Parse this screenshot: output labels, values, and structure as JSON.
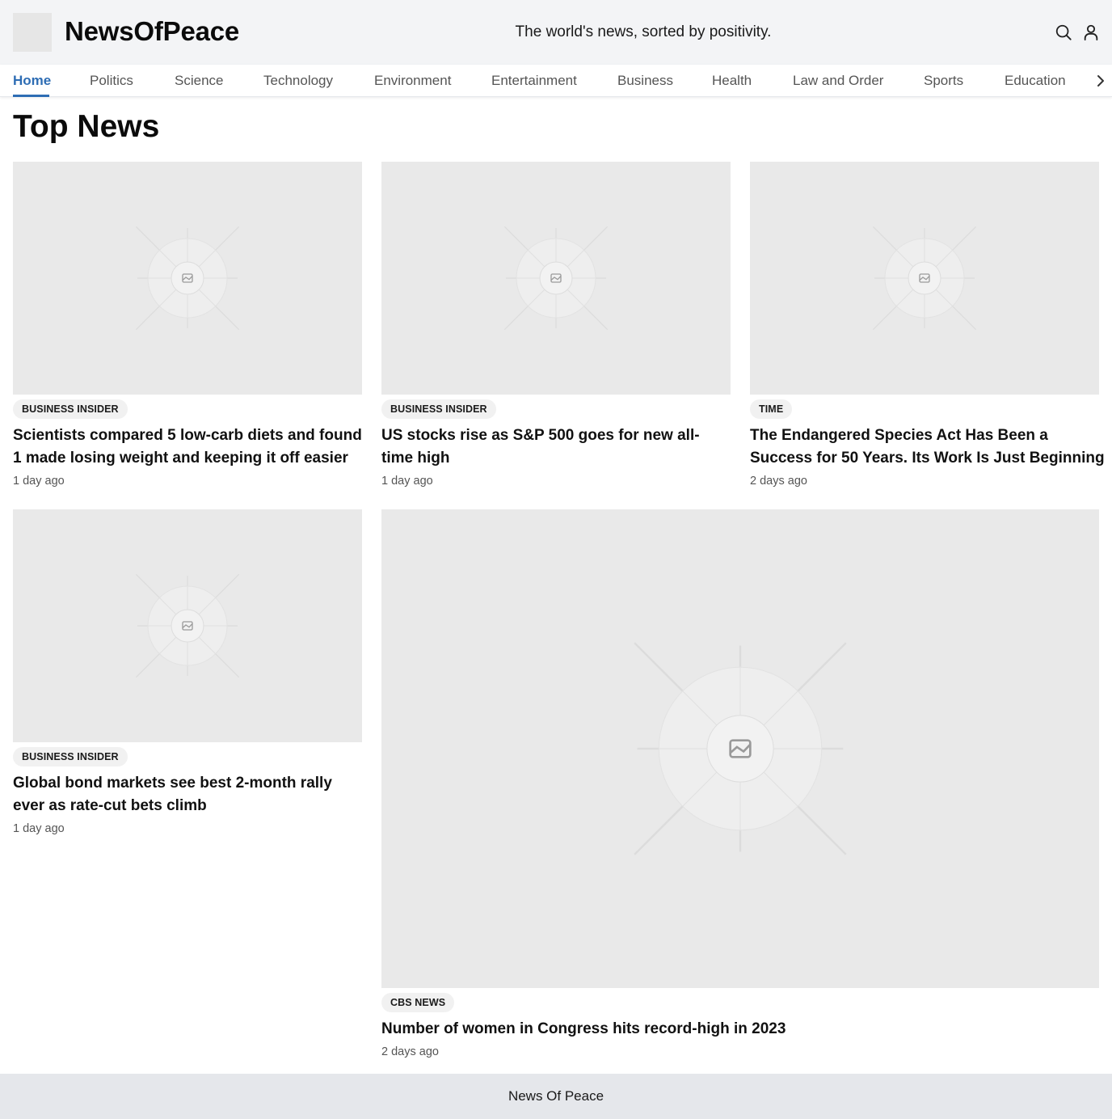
{
  "header": {
    "brand": "NewsOfPeace",
    "tagline": "The world's news, sorted by positivity.",
    "icons": [
      "search-icon",
      "user-icon"
    ]
  },
  "nav": {
    "items": [
      "Home",
      "Politics",
      "Science",
      "Technology",
      "Environment",
      "Entertainment",
      "Business",
      "Health",
      "Law and Order",
      "Sports",
      "Education"
    ],
    "active": "Home",
    "next_icon": "chevron-right-icon"
  },
  "page": {
    "title": "Top News"
  },
  "articles": [
    {
      "source": "BUSINESS INSIDER",
      "headline": "Scientists compared 5 low-carb diets and found 1 made losing weight and keeping it off easier",
      "time": "1 day ago"
    },
    {
      "source": "BUSINESS INSIDER",
      "headline": "US stocks rise as S&P 500 goes for new all-time high",
      "time": "1 day ago"
    },
    {
      "source": "TIME",
      "headline": "The Endangered Species Act Has Been a Success for 50 Years. Its Work Is Just Beginning",
      "time": "2 days ago"
    },
    {
      "source": "BUSINESS INSIDER",
      "headline": "Global bond markets see best 2-month rally ever as rate-cut bets climb",
      "time": "1 day ago"
    },
    {
      "source": "CBS NEWS",
      "headline": "Number of women in Congress hits record-high in 2023",
      "time": "2 days ago"
    }
  ],
  "footer": {
    "text": "News Of Peace"
  },
  "colors": {
    "accent": "#2e6db4",
    "header_bg": "#f3f4f6",
    "placeholder_bg": "#e9e9e9",
    "footer_bg": "#e5e7eb"
  }
}
